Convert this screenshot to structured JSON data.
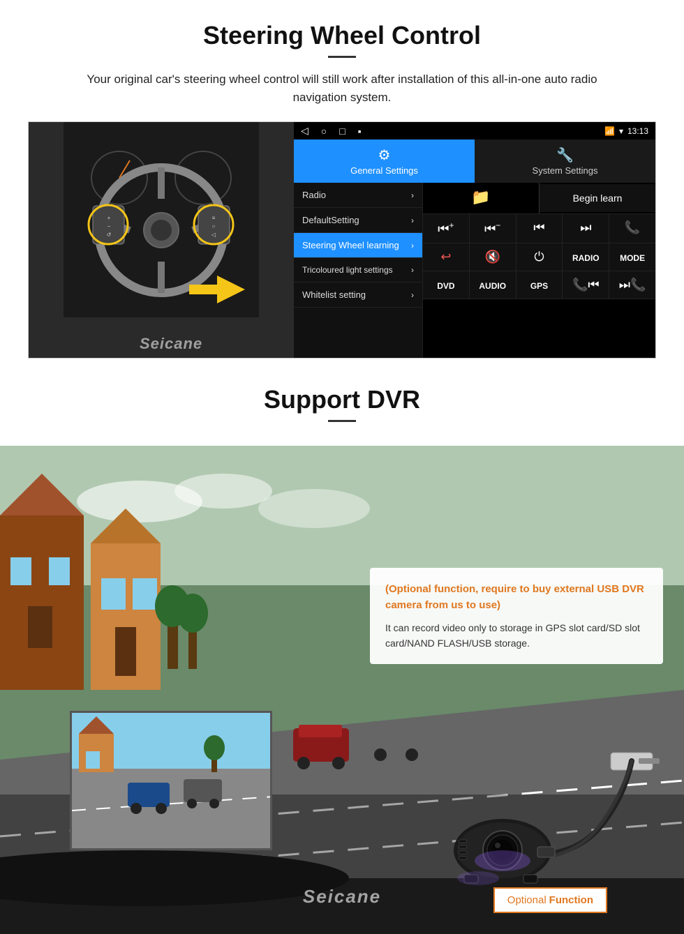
{
  "steering": {
    "title": "Steering Wheel Control",
    "subtitle": "Your original car's steering wheel control will still work after installation of this all-in-one auto radio navigation system.",
    "statusbar": {
      "nav_back": "◁",
      "nav_home": "○",
      "nav_square": "□",
      "nav_menu": "▪",
      "time": "13:13",
      "signal": "▼",
      "wifi": "▾"
    },
    "tabs": {
      "general": {
        "icon": "⚙",
        "label": "General Settings",
        "active": true
      },
      "system": {
        "icon": "🔧",
        "label": "System Settings",
        "active": false
      }
    },
    "menu_items": [
      {
        "label": "Radio",
        "active": false,
        "has_arrow": true
      },
      {
        "label": "DefaultSetting",
        "active": false,
        "has_arrow": true
      },
      {
        "label": "Steering Wheel learning",
        "active": true,
        "has_arrow": true
      },
      {
        "label": "Tricoloured light settings",
        "active": false,
        "has_arrow": true
      },
      {
        "label": "Whitelist setting",
        "active": false,
        "has_arrow": true
      }
    ],
    "begin_learn": "Begin learn",
    "control_rows": [
      [
        "⏮+",
        "⏮−",
        "⏮⏮",
        "⏭⏭",
        "📞"
      ],
      [
        "↩",
        "🔇",
        "⏻",
        "RADIO",
        "MODE"
      ],
      [
        "DVD",
        "AUDIO",
        "GPS",
        "📞⏮",
        "⏭📞"
      ]
    ],
    "seicane_watermark": "Seicane"
  },
  "dvr": {
    "title": "Support DVR",
    "info_card": {
      "orange_text": "(Optional function, require to buy external USB DVR camera from us to use)",
      "body_text": "It can record video only to storage in GPS slot card/SD slot card/NAND FLASH/USB storage."
    },
    "optional_function": {
      "optional_label": "Optional",
      "function_label": "Function"
    },
    "seicane_watermark": "Seicane"
  }
}
